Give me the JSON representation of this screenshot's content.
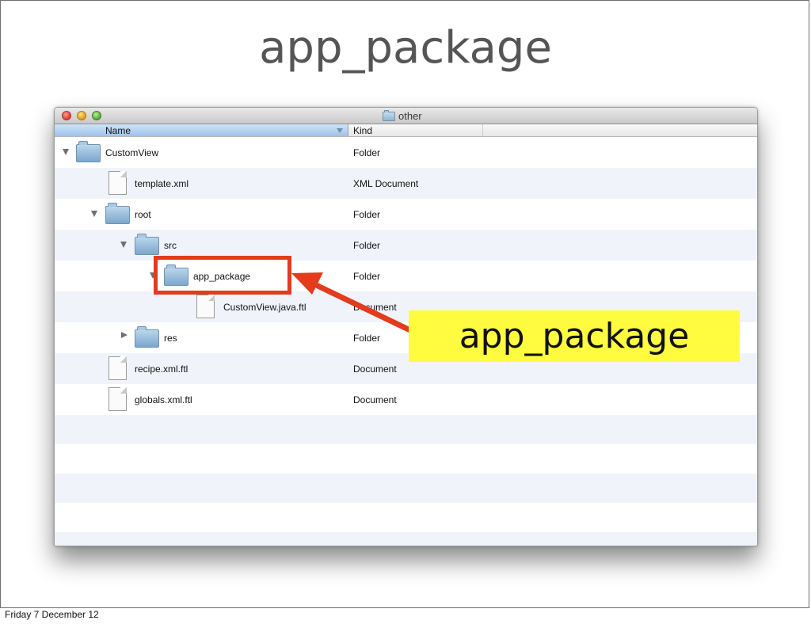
{
  "slide": {
    "title": "app_package",
    "footer": "Friday 7 December 12"
  },
  "window": {
    "title": "other",
    "title_icon": "folder-icon",
    "columns": {
      "name": "Name",
      "kind": "Kind"
    },
    "rows": [
      {
        "name": "CustomView",
        "kind": "Folder",
        "icon": "folder-icon",
        "disclosure": "open"
      },
      {
        "name": "template.xml",
        "kind": "XML Document",
        "icon": "document-icon",
        "disclosure": "none"
      },
      {
        "name": "root",
        "kind": "Folder",
        "icon": "folder-icon",
        "disclosure": "open"
      },
      {
        "name": "src",
        "kind": "Folder",
        "icon": "folder-icon",
        "disclosure": "open"
      },
      {
        "name": "app_package",
        "kind": "Folder",
        "icon": "folder-icon",
        "disclosure": "open"
      },
      {
        "name": "CustomView.java.ftl",
        "kind": "Document",
        "icon": "document-icon",
        "disclosure": "none"
      },
      {
        "name": "res",
        "kind": "Folder",
        "icon": "folder-icon",
        "disclosure": "closed"
      },
      {
        "name": "recipe.xml.ftl",
        "kind": "Document",
        "icon": "document-icon",
        "disclosure": "none"
      },
      {
        "name": "globals.xml.ftl",
        "kind": "Document",
        "icon": "document-icon",
        "disclosure": "none"
      }
    ]
  },
  "annotation": {
    "callout_text": "app_package",
    "highlight_color": "#e23b1d",
    "callout_color": "#fffb3f"
  }
}
